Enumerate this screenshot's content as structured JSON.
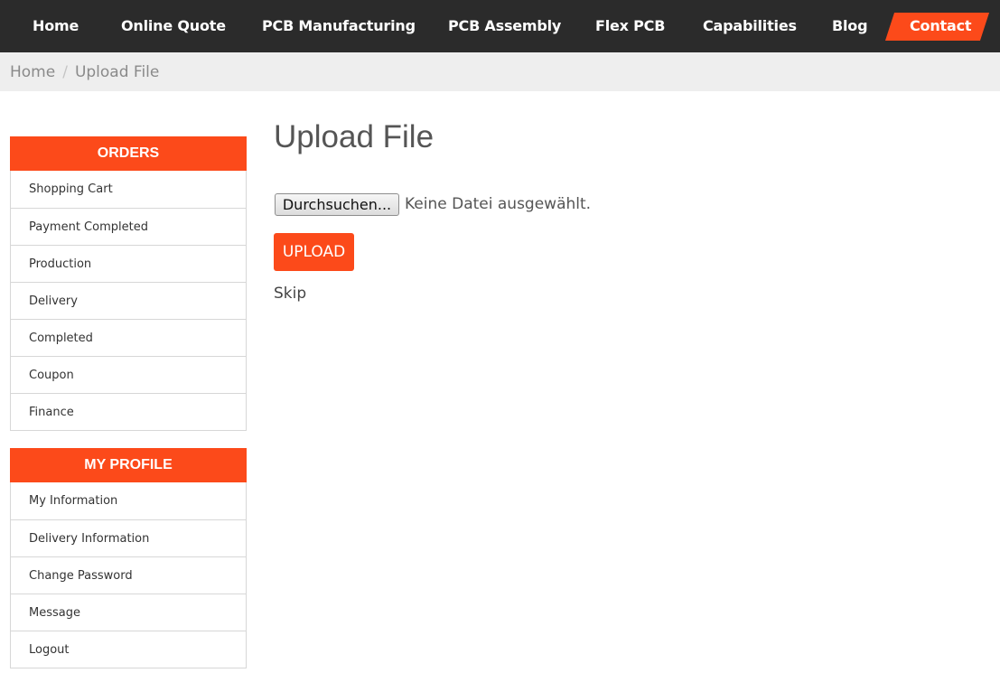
{
  "nav": {
    "home": "Home",
    "online_quote": "Online Quote",
    "pcb_manufacturing": "PCB Manufacturing",
    "pcb_assembly": "PCB Assembly",
    "flex_pcb": "Flex PCB",
    "capabilities": "Capabilities",
    "blog": "Blog",
    "contact": "Contact"
  },
  "breadcrumb": {
    "home": "Home",
    "separator": "/",
    "current": "Upload File"
  },
  "sidebar": {
    "orders": {
      "title": "ORDERS",
      "items": [
        "Shopping Cart",
        "Payment Completed",
        "Production",
        "Delivery",
        "Completed",
        "Coupon",
        "Finance"
      ]
    },
    "profile": {
      "title": "MY PROFILE",
      "items": [
        "My Information",
        "Delivery Information",
        "Change Password",
        "Message",
        "Logout"
      ]
    }
  },
  "main": {
    "title": "Upload File",
    "browse_button": "Durchsuchen...",
    "file_status": "Keine Datei ausgewählt.",
    "upload_button": "UPLOAD",
    "skip_link": "Skip"
  },
  "colors": {
    "accent": "#fc4a1a",
    "nav_bg": "#2b2b2b",
    "breadcrumb_bg": "#eeeeee"
  }
}
